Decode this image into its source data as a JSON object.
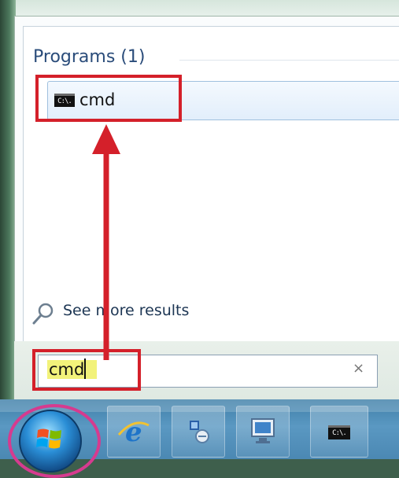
{
  "start_menu": {
    "section_title": "Programs (1)",
    "results": [
      {
        "label": "cmd",
        "icon": "command-prompt-icon",
        "icon_text": "C:\\."
      }
    ],
    "see_more": "See more results"
  },
  "search": {
    "value": "cmd",
    "clear": "×"
  },
  "taskbar": {
    "items": [
      {
        "name": "start-button",
        "icon": "windows-logo-icon"
      },
      {
        "name": "internet-explorer",
        "icon": "internet-explorer-icon"
      },
      {
        "name": "network-connections",
        "icon": "network-icon"
      },
      {
        "name": "remote-desktop",
        "icon": "remote-desktop-icon"
      },
      {
        "name": "command-prompt",
        "icon": "command-prompt-icon",
        "icon_text": "C:\\."
      }
    ]
  },
  "colors": {
    "annotation_red": "#d4202a",
    "annotation_pink": "#d63b8f",
    "search_highlight": "#f2f27a"
  }
}
